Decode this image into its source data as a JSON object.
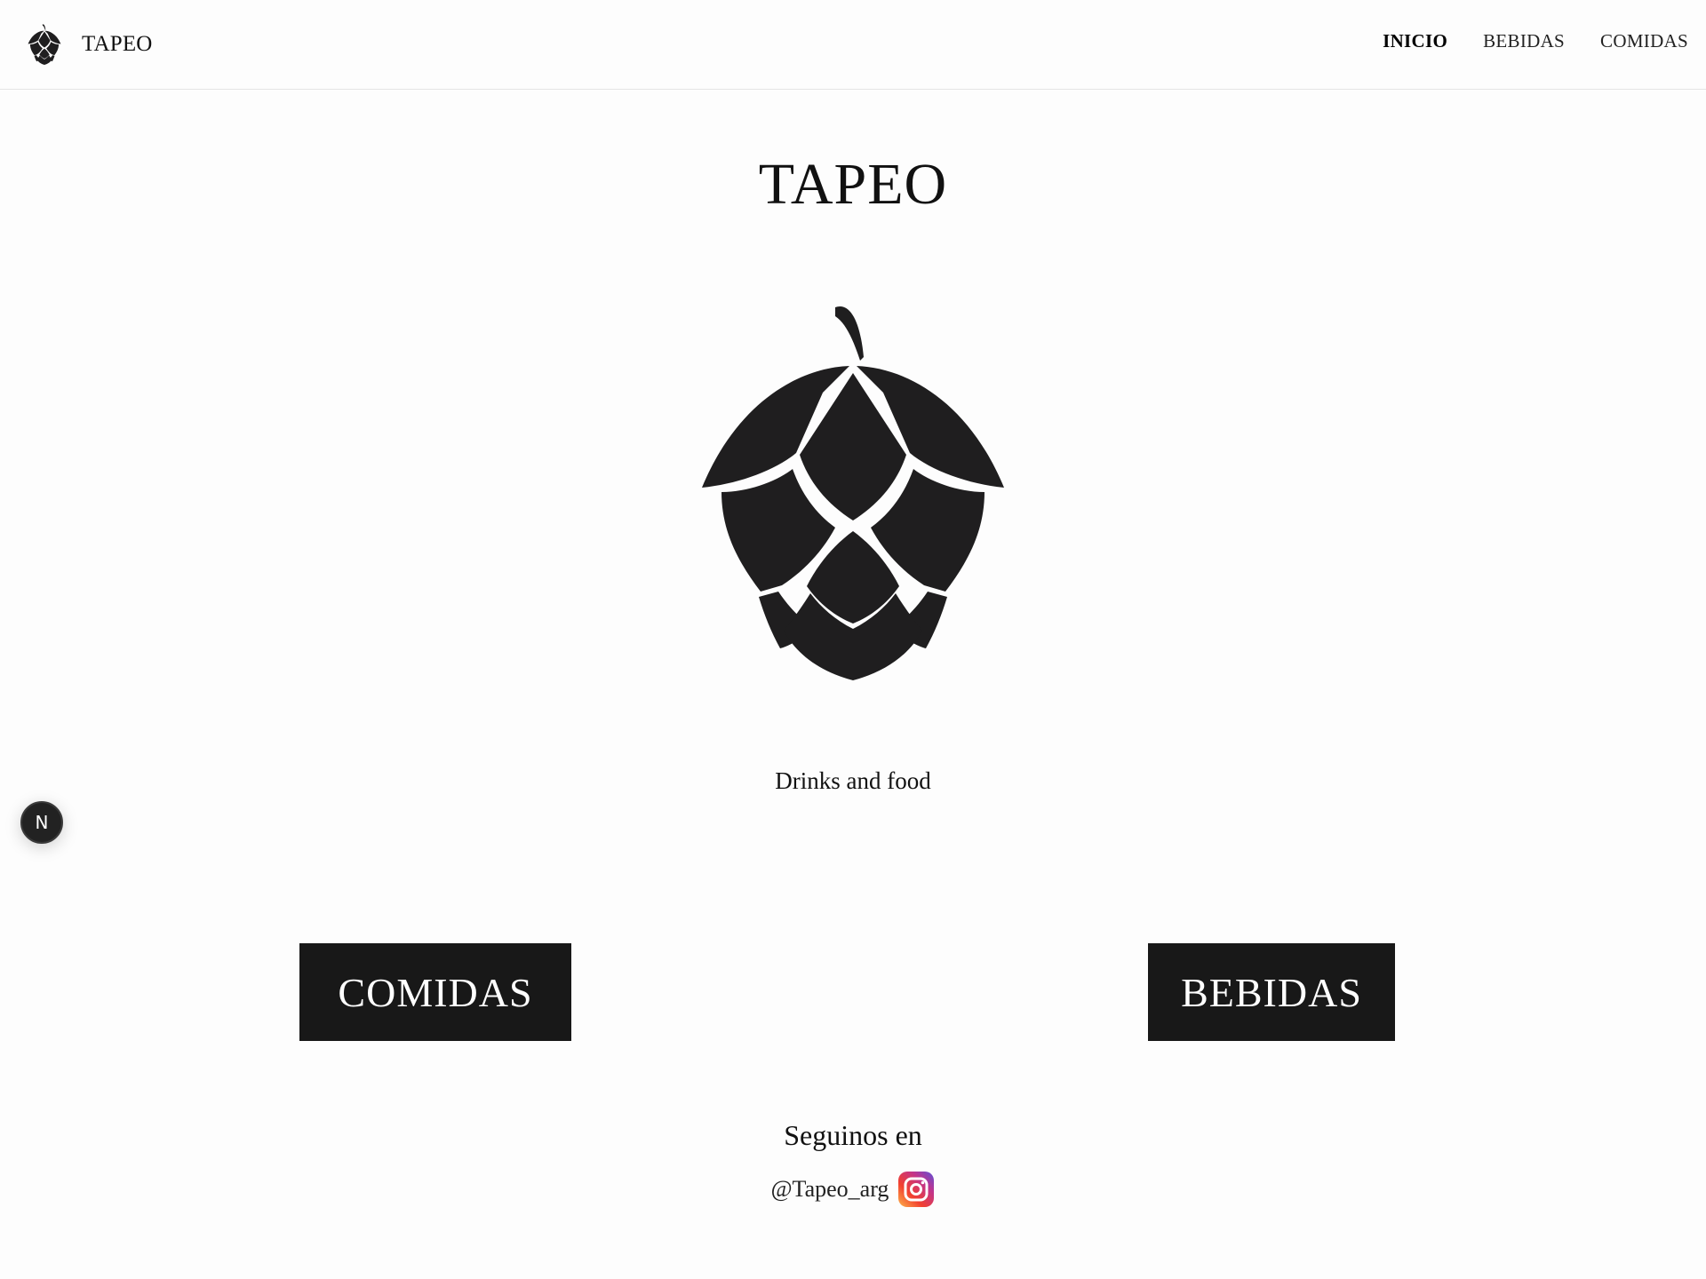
{
  "navbar": {
    "brand_name": "TAPEO",
    "brand_icon": "hop-icon",
    "links": [
      {
        "label": "INICIO",
        "active": true
      },
      {
        "label": "BEBIDAS",
        "active": false
      },
      {
        "label": "COMIDAS",
        "active": false
      }
    ]
  },
  "hero": {
    "title": "TAPEO",
    "logo_icon": "hop-icon",
    "tagline": "Drinks and food"
  },
  "actions": {
    "comidas_label": "COMIDAS",
    "bebidas_label": "BEBIDAS"
  },
  "social": {
    "title": "Seguinos en",
    "handle": "@Tapeo_arg",
    "icon": "instagram-icon"
  },
  "dev_badge": {
    "label": "N"
  },
  "colors": {
    "background": "#fdfdfd",
    "text": "#111111",
    "button_bg": "#181818",
    "button_text": "#ffffff",
    "hop_fill": "#1f1e1f"
  }
}
